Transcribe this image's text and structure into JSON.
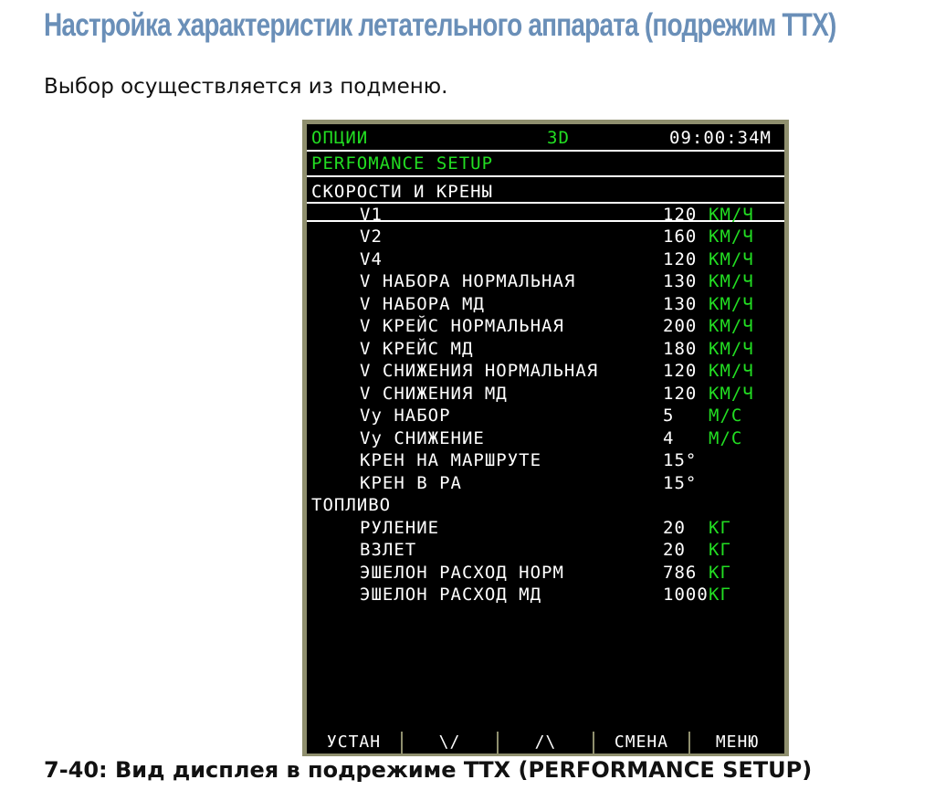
{
  "heading": "Настройка характеристик летательного аппарата (подрежим ТТХ)",
  "intro": "Выбор осуществляется из подменю.",
  "display": {
    "status": {
      "options": "ОПЦИИ",
      "mode": "3D",
      "clock": "09:00:34M"
    },
    "page_title": "PERFOMANCE SETUP",
    "sections": [
      {
        "title": "СКОРОСТИ И КРЕНЫ",
        "rows": [
          {
            "label": "V1",
            "value": "120",
            "unit": "КМ/Ч",
            "selected": true
          },
          {
            "label": "V2",
            "value": "160",
            "unit": "КМ/Ч"
          },
          {
            "label": "V4",
            "value": "120",
            "unit": "КМ/Ч"
          },
          {
            "label": "V НАБОРА НОРМАЛЬНАЯ",
            "value": "130",
            "unit": "КМ/Ч"
          },
          {
            "label": "V НАБОРА МД",
            "value": "130",
            "unit": "КМ/Ч"
          },
          {
            "label": "V КРЕЙС НОРМАЛЬНАЯ",
            "value": "200",
            "unit": "КМ/Ч"
          },
          {
            "label": "V КРЕЙС МД",
            "value": "180",
            "unit": "КМ/Ч"
          },
          {
            "label": "V СНИЖЕНИЯ НОРМАЛЬНАЯ",
            "value": "120",
            "unit": "КМ/Ч"
          },
          {
            "label": "V СНИЖЕНИЯ МД",
            "value": "120",
            "unit": "КМ/Ч"
          },
          {
            "label": "Vy НАБОР",
            "value": "5",
            "unit": "М/С"
          },
          {
            "label": "Vy СНИЖЕНИЕ",
            "value": "4",
            "unit": "М/С"
          },
          {
            "label": "КРЕН НА МАРШРУТЕ",
            "value": "15°",
            "unit": ""
          },
          {
            "label": "КРЕН В РА",
            "value": "15°",
            "unit": ""
          }
        ]
      },
      {
        "title": "ТОПЛИВО",
        "rows": [
          {
            "label": "РУЛЕНИЕ",
            "value": "20",
            "unit": "КГ"
          },
          {
            "label": "ВЗЛЕТ",
            "value": "20",
            "unit": "КГ"
          },
          {
            "label": "ЭШЕЛОН РАСХОД НОРМ",
            "value": "786",
            "unit": "КГ"
          },
          {
            "label": "ЭШЕЛОН РАСХОД МД",
            "value": "1000",
            "unit": "КГ"
          }
        ]
      }
    ],
    "softkeys": [
      "УСТАН",
      "\\/",
      "/\\",
      "СМЕНА",
      "МЕНЮ"
    ]
  },
  "caption": "7-40: Вид дисплея в подрежиме ТТХ (PERFORMANCE SETUP)"
}
